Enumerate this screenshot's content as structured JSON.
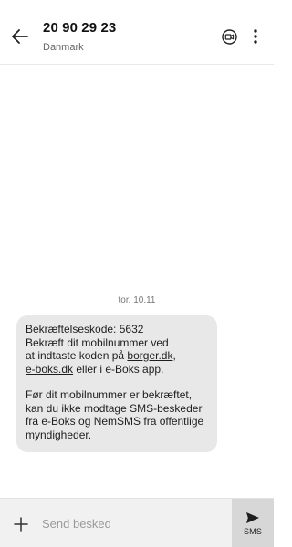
{
  "header": {
    "contact_name": "20 90 29 23",
    "contact_subtitle": "Danmark",
    "icons": {
      "back": "arrow-left-icon",
      "video": "video-call-icon",
      "more": "more-vertical-icon"
    }
  },
  "conversation": {
    "date_separator": "tor. 10.11",
    "message": {
      "line1": "Bekræftelseskode: 5632",
      "line2": "Bekræft dit mobilnummer ved",
      "line3_prefix": "at indtaste koden på ",
      "link1": "borger.dk",
      "line3_suffix": ",",
      "link2": "e-boks.dk",
      "line4_suffix": " eller i e-Boks app.",
      "paragraph2": "Før dit mobilnummer er bekræftet, kan du ikke modtage SMS-beskeder fra e-Boks og NemSMS fra offentlige myndigheder."
    }
  },
  "composer": {
    "placeholder": "Send besked",
    "value": "",
    "send_label": "SMS",
    "icons": {
      "add": "plus-icon",
      "send": "send-icon"
    }
  },
  "colors": {
    "bubble_bg": "#e8e8e8",
    "composer_bg": "#f1f1f1",
    "send_bg": "#d7d7d7"
  }
}
